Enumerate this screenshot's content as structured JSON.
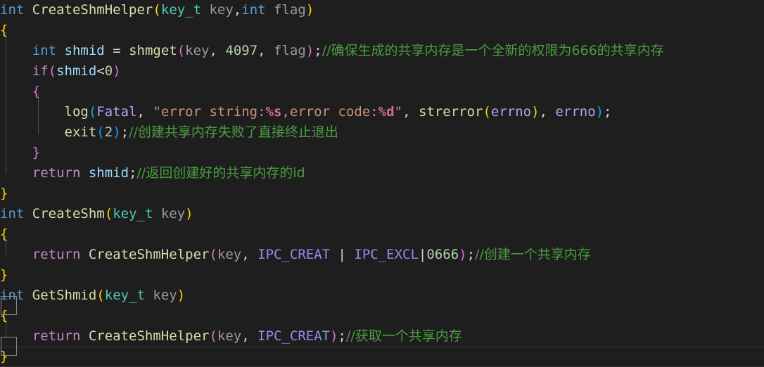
{
  "editor": {
    "language": "C++",
    "theme": "Dark+ (default dark)",
    "background_color": "#1e1e1e",
    "current_line_border_color": "#333436",
    "indent_guide_color": "#4e4e4e",
    "bracket_match_border_color": "#888888",
    "font_size_px": 19,
    "line_height_px": 29
  },
  "colors": {
    "keyword": "#569cd6",
    "control_keyword": "#c586c0",
    "function": "#dcdcaa",
    "type": "#4ec9b0",
    "parameter": "#9a9a9a",
    "variable": "#9cdcfe",
    "number": "#b5cea8",
    "string": "#ce9178",
    "format_specifier": "#d16d9e",
    "comment": "#4a9d3f",
    "macro": "#8e8ef0",
    "enum_value": "#b3a0f5",
    "bracket_level_1": "#ffd700",
    "bracket_level_2": "#da70d6",
    "bracket_level_3": "#179fff"
  },
  "code": {
    "lines": [
      {
        "index": 0,
        "current": false,
        "tokens": [
          {
            "t": "int",
            "c": "kw"
          },
          {
            "t": " ",
            "c": "op"
          },
          {
            "t": "CreateShmHelper",
            "c": "fn"
          },
          {
            "t": "(",
            "c": "p-yellow"
          },
          {
            "t": "key_t",
            "c": "type"
          },
          {
            "t": " ",
            "c": "op"
          },
          {
            "t": "key",
            "c": "param"
          },
          {
            "t": ",",
            "c": "punct"
          },
          {
            "t": "int",
            "c": "kw"
          },
          {
            "t": " ",
            "c": "op"
          },
          {
            "t": "flag",
            "c": "param"
          },
          {
            "t": ")",
            "c": "p-yellow"
          }
        ]
      },
      {
        "index": 1,
        "current": false,
        "tokens": [
          {
            "t": "{",
            "c": "brace-y"
          }
        ]
      },
      {
        "index": 2,
        "current": false,
        "tokens": [
          {
            "t": "    ",
            "c": "op"
          },
          {
            "t": "int",
            "c": "kw"
          },
          {
            "t": " ",
            "c": "op"
          },
          {
            "t": "shmid",
            "c": "var"
          },
          {
            "t": " = ",
            "c": "op"
          },
          {
            "t": "shmget",
            "c": "fn"
          },
          {
            "t": "(",
            "c": "p-pink"
          },
          {
            "t": "key",
            "c": "param"
          },
          {
            "t": ", ",
            "c": "punct"
          },
          {
            "t": "4097",
            "c": "num"
          },
          {
            "t": ", ",
            "c": "punct"
          },
          {
            "t": "flag",
            "c": "param"
          },
          {
            "t": ")",
            "c": "p-pink"
          },
          {
            "t": ";",
            "c": "punct"
          },
          {
            "t": "//确保生成的共享内存是一个全新的权限为666的共享内存",
            "c": "cmt cjk"
          }
        ]
      },
      {
        "index": 3,
        "current": false,
        "tokens": [
          {
            "t": "    ",
            "c": "op"
          },
          {
            "t": "if",
            "c": "kwctl"
          },
          {
            "t": "(",
            "c": "p-pink"
          },
          {
            "t": "shmid",
            "c": "var"
          },
          {
            "t": "<",
            "c": "op"
          },
          {
            "t": "0",
            "c": "num"
          },
          {
            "t": ")",
            "c": "p-pink"
          }
        ]
      },
      {
        "index": 4,
        "current": false,
        "tokens": [
          {
            "t": "    ",
            "c": "op"
          },
          {
            "t": "{",
            "c": "brace-p"
          }
        ]
      },
      {
        "index": 5,
        "current": false,
        "tokens": [
          {
            "t": "        ",
            "c": "op"
          },
          {
            "t": "log",
            "c": "fn"
          },
          {
            "t": "(",
            "c": "p-blue"
          },
          {
            "t": "Fatal",
            "c": "enumv"
          },
          {
            "t": ", ",
            "c": "punct"
          },
          {
            "t": "\"error string:",
            "c": "str"
          },
          {
            "t": "%s",
            "c": "fmt"
          },
          {
            "t": ",error code:",
            "c": "str"
          },
          {
            "t": "%d",
            "c": "fmt"
          },
          {
            "t": "\"",
            "c": "str"
          },
          {
            "t": ", ",
            "c": "punct"
          },
          {
            "t": "strerror",
            "c": "fn"
          },
          {
            "t": "(",
            "c": "p-yellow"
          },
          {
            "t": "errno",
            "c": "enumv"
          },
          {
            "t": ")",
            "c": "p-yellow"
          },
          {
            "t": ", ",
            "c": "punct"
          },
          {
            "t": "errno",
            "c": "enumv"
          },
          {
            "t": ")",
            "c": "p-blue"
          },
          {
            "t": ";",
            "c": "punct"
          }
        ]
      },
      {
        "index": 6,
        "current": false,
        "tokens": [
          {
            "t": "        ",
            "c": "op"
          },
          {
            "t": "exit",
            "c": "fn"
          },
          {
            "t": "(",
            "c": "p-blue"
          },
          {
            "t": "2",
            "c": "num"
          },
          {
            "t": ")",
            "c": "p-blue"
          },
          {
            "t": ";",
            "c": "punct"
          },
          {
            "t": "//创建共享内存失败了直接终止退出",
            "c": "cmt cjk"
          }
        ]
      },
      {
        "index": 7,
        "current": false,
        "tokens": [
          {
            "t": "    ",
            "c": "op"
          },
          {
            "t": "}",
            "c": "brace-p"
          }
        ]
      },
      {
        "index": 8,
        "current": false,
        "tokens": [
          {
            "t": "    ",
            "c": "op"
          },
          {
            "t": "return",
            "c": "kwctl"
          },
          {
            "t": " ",
            "c": "op"
          },
          {
            "t": "shmid",
            "c": "var"
          },
          {
            "t": ";",
            "c": "punct"
          },
          {
            "t": "//返回创建好的共享内存的id",
            "c": "cmt cjk"
          }
        ]
      },
      {
        "index": 9,
        "current": false,
        "tokens": [
          {
            "t": "}",
            "c": "brace-y"
          }
        ]
      },
      {
        "index": 10,
        "current": false,
        "tokens": [
          {
            "t": "int",
            "c": "kw"
          },
          {
            "t": " ",
            "c": "op"
          },
          {
            "t": "CreateShm",
            "c": "fn"
          },
          {
            "t": "(",
            "c": "p-yellow"
          },
          {
            "t": "key_t",
            "c": "type"
          },
          {
            "t": " ",
            "c": "op"
          },
          {
            "t": "key",
            "c": "param"
          },
          {
            "t": ")",
            "c": "p-yellow"
          }
        ]
      },
      {
        "index": 11,
        "current": false,
        "tokens": [
          {
            "t": "{",
            "c": "brace-y"
          }
        ]
      },
      {
        "index": 12,
        "current": false,
        "tokens": [
          {
            "t": "    ",
            "c": "op"
          },
          {
            "t": "return",
            "c": "kwctl"
          },
          {
            "t": " ",
            "c": "op"
          },
          {
            "t": "CreateShmHelper",
            "c": "fn"
          },
          {
            "t": "(",
            "c": "p-pink"
          },
          {
            "t": "key",
            "c": "param"
          },
          {
            "t": ", ",
            "c": "punct"
          },
          {
            "t": "IPC_CREAT",
            "c": "macro"
          },
          {
            "t": " | ",
            "c": "op"
          },
          {
            "t": "IPC_EXCL",
            "c": "macro"
          },
          {
            "t": "|",
            "c": "op"
          },
          {
            "t": "0666",
            "c": "num"
          },
          {
            "t": ")",
            "c": "p-pink"
          },
          {
            "t": ";",
            "c": "punct"
          },
          {
            "t": "//创建一个共享内存",
            "c": "cmt cjk"
          }
        ]
      },
      {
        "index": 13,
        "current": false,
        "tokens": [
          {
            "t": "}",
            "c": "brace-y"
          }
        ]
      },
      {
        "index": 14,
        "current": false,
        "tokens": [
          {
            "t": "int",
            "c": "kw"
          },
          {
            "t": " ",
            "c": "op"
          },
          {
            "t": "GetShmid",
            "c": "fn"
          },
          {
            "t": "(",
            "c": "p-yellow"
          },
          {
            "t": "key_t",
            "c": "type"
          },
          {
            "t": " ",
            "c": "op"
          },
          {
            "t": "key",
            "c": "param"
          },
          {
            "t": ")",
            "c": "p-yellow"
          }
        ]
      },
      {
        "index": 15,
        "current": false,
        "bracket_match": true,
        "tokens": [
          {
            "t": "{",
            "c": "brace-y"
          }
        ]
      },
      {
        "index": 16,
        "current": false,
        "tokens": [
          {
            "t": "    ",
            "c": "op"
          },
          {
            "t": "return",
            "c": "kwctl"
          },
          {
            "t": " ",
            "c": "op"
          },
          {
            "t": "CreateShmHelper",
            "c": "fn"
          },
          {
            "t": "(",
            "c": "p-pink"
          },
          {
            "t": "key",
            "c": "param"
          },
          {
            "t": ", ",
            "c": "punct"
          },
          {
            "t": "IPC_CREAT",
            "c": "macro"
          },
          {
            "t": ")",
            "c": "p-pink"
          },
          {
            "t": ";",
            "c": "punct"
          },
          {
            "t": "//获取一个共享内存",
            "c": "cmt cjk"
          }
        ]
      },
      {
        "index": 17,
        "current": true,
        "bracket_match": true,
        "tokens": [
          {
            "t": "}",
            "c": "brace-y"
          }
        ]
      }
    ]
  },
  "source_text": "int CreateShmHelper(key_t key,int flag)\n{\n    int shmid = shmget(key, 4097, flag);//确保生成的共享内存是一个全新的权限为666的共享内存\n    if(shmid<0)\n    {\n        log(Fatal, \"error string:%s,error code:%d\", strerror(errno), errno);\n        exit(2);//创建共享内存失败了直接终止退出\n    }\n    return shmid;//返回创建好的共享内存的id\n}\nint CreateShm(key_t key)\n{\n    return CreateShmHelper(key, IPC_CREAT | IPC_EXCL|0666);//创建一个共享内存\n}\nint GetShmid(key_t key)\n{\n    return CreateShmHelper(key, IPC_CREAT);//获取一个共享内存\n}"
}
